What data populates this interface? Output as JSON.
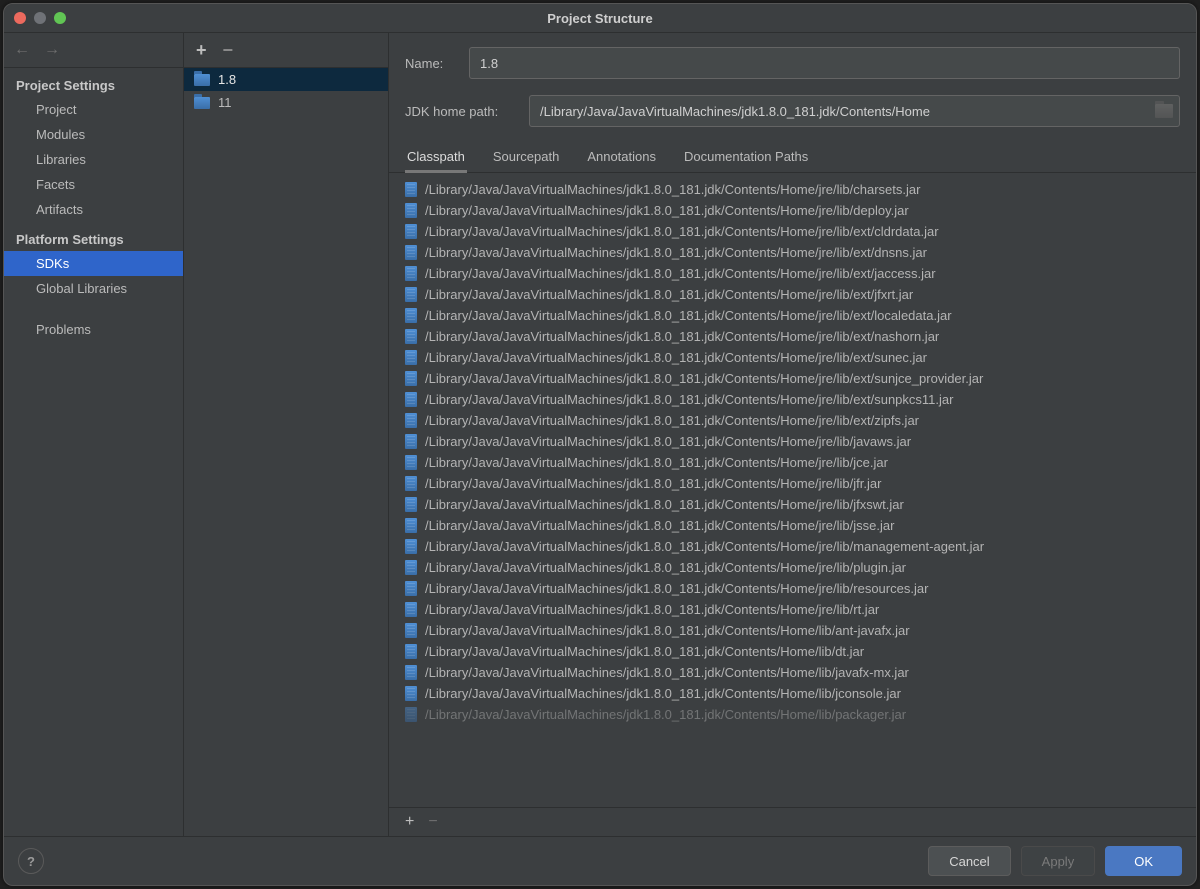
{
  "window": {
    "title": "Project Structure"
  },
  "sidebar": {
    "groups": [
      {
        "heading": "Project Settings",
        "items": [
          {
            "label": "Project",
            "selected": false
          },
          {
            "label": "Modules",
            "selected": false
          },
          {
            "label": "Libraries",
            "selected": false
          },
          {
            "label": "Facets",
            "selected": false
          },
          {
            "label": "Artifacts",
            "selected": false
          }
        ]
      },
      {
        "heading": "Platform Settings",
        "items": [
          {
            "label": "SDKs",
            "selected": true
          },
          {
            "label": "Global Libraries",
            "selected": false
          }
        ]
      },
      {
        "heading": "",
        "items": [
          {
            "label": "Problems",
            "selected": false
          }
        ]
      }
    ]
  },
  "sdkList": {
    "items": [
      {
        "label": "1.8",
        "selected": true
      },
      {
        "label": "11",
        "selected": false
      }
    ]
  },
  "detail": {
    "nameLabel": "Name:",
    "nameValue": "1.8",
    "pathLabel": "JDK home path:",
    "pathValue": "/Library/Java/JavaVirtualMachines/jdk1.8.0_181.jdk/Contents/Home",
    "tabs": [
      {
        "label": "Classpath",
        "active": true
      },
      {
        "label": "Sourcepath",
        "active": false
      },
      {
        "label": "Annotations",
        "active": false
      },
      {
        "label": "Documentation Paths",
        "active": false
      }
    ],
    "classpath": [
      "/Library/Java/JavaVirtualMachines/jdk1.8.0_181.jdk/Contents/Home/jre/lib/charsets.jar",
      "/Library/Java/JavaVirtualMachines/jdk1.8.0_181.jdk/Contents/Home/jre/lib/deploy.jar",
      "/Library/Java/JavaVirtualMachines/jdk1.8.0_181.jdk/Contents/Home/jre/lib/ext/cldrdata.jar",
      "/Library/Java/JavaVirtualMachines/jdk1.8.0_181.jdk/Contents/Home/jre/lib/ext/dnsns.jar",
      "/Library/Java/JavaVirtualMachines/jdk1.8.0_181.jdk/Contents/Home/jre/lib/ext/jaccess.jar",
      "/Library/Java/JavaVirtualMachines/jdk1.8.0_181.jdk/Contents/Home/jre/lib/ext/jfxrt.jar",
      "/Library/Java/JavaVirtualMachines/jdk1.8.0_181.jdk/Contents/Home/jre/lib/ext/localedata.jar",
      "/Library/Java/JavaVirtualMachines/jdk1.8.0_181.jdk/Contents/Home/jre/lib/ext/nashorn.jar",
      "/Library/Java/JavaVirtualMachines/jdk1.8.0_181.jdk/Contents/Home/jre/lib/ext/sunec.jar",
      "/Library/Java/JavaVirtualMachines/jdk1.8.0_181.jdk/Contents/Home/jre/lib/ext/sunjce_provider.jar",
      "/Library/Java/JavaVirtualMachines/jdk1.8.0_181.jdk/Contents/Home/jre/lib/ext/sunpkcs11.jar",
      "/Library/Java/JavaVirtualMachines/jdk1.8.0_181.jdk/Contents/Home/jre/lib/ext/zipfs.jar",
      "/Library/Java/JavaVirtualMachines/jdk1.8.0_181.jdk/Contents/Home/jre/lib/javaws.jar",
      "/Library/Java/JavaVirtualMachines/jdk1.8.0_181.jdk/Contents/Home/jre/lib/jce.jar",
      "/Library/Java/JavaVirtualMachines/jdk1.8.0_181.jdk/Contents/Home/jre/lib/jfr.jar",
      "/Library/Java/JavaVirtualMachines/jdk1.8.0_181.jdk/Contents/Home/jre/lib/jfxswt.jar",
      "/Library/Java/JavaVirtualMachines/jdk1.8.0_181.jdk/Contents/Home/jre/lib/jsse.jar",
      "/Library/Java/JavaVirtualMachines/jdk1.8.0_181.jdk/Contents/Home/jre/lib/management-agent.jar",
      "/Library/Java/JavaVirtualMachines/jdk1.8.0_181.jdk/Contents/Home/jre/lib/plugin.jar",
      "/Library/Java/JavaVirtualMachines/jdk1.8.0_181.jdk/Contents/Home/jre/lib/resources.jar",
      "/Library/Java/JavaVirtualMachines/jdk1.8.0_181.jdk/Contents/Home/jre/lib/rt.jar",
      "/Library/Java/JavaVirtualMachines/jdk1.8.0_181.jdk/Contents/Home/lib/ant-javafx.jar",
      "/Library/Java/JavaVirtualMachines/jdk1.8.0_181.jdk/Contents/Home/lib/dt.jar",
      "/Library/Java/JavaVirtualMachines/jdk1.8.0_181.jdk/Contents/Home/lib/javafx-mx.jar",
      "/Library/Java/JavaVirtualMachines/jdk1.8.0_181.jdk/Contents/Home/lib/jconsole.jar",
      "/Library/Java/JavaVirtualMachines/jdk1.8.0_181.jdk/Contents/Home/lib/packager.jar"
    ]
  },
  "footer": {
    "cancel": "Cancel",
    "apply": "Apply",
    "ok": "OK"
  }
}
